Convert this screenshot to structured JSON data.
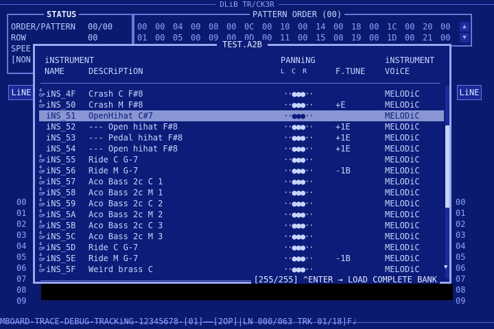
{
  "top_title": "DLiB TR/CK3R",
  "status": {
    "title": "STATUS",
    "lines": [
      {
        "label": "ORDER/PATTERN",
        "value": "00/00"
      },
      {
        "label": "ROW",
        "value": "00"
      },
      {
        "label": "SPEE",
        "value": ""
      },
      {
        "label": "[NON",
        "value": ""
      }
    ]
  },
  "pattern_order": {
    "title": "PATTERN ORDER (00)",
    "row1": [
      "00",
      "00",
      "04",
      "00",
      "08",
      "00",
      "0C",
      "00",
      "10",
      "00",
      "14",
      "00",
      "18",
      "00",
      "1C",
      "00",
      "20",
      "00"
    ],
    "row2": [
      "01",
      "00",
      "05",
      "00",
      "09",
      "00",
      "0D",
      "00",
      "11",
      "00",
      "15",
      "00",
      "19",
      "00",
      "1D",
      "00",
      "21",
      "00"
    ]
  },
  "lin_label": "LiNE",
  "track_numbers": [
    "00",
    "01",
    "02",
    "03",
    "04",
    "05",
    "06",
    "07",
    "08",
    "09"
  ],
  "dialog": {
    "title": "TEST.A2B",
    "headers": {
      "instrument_top": "iNSTRUMENT",
      "name": "NAME",
      "description": "DESCRiPTiON",
      "panning": "PANNiNG",
      "pan_lcr": "L   C   R",
      "ftune": "F.TUNE",
      "instrument_voice_top": "iNSTRUMENT",
      "voice": "VOiCE"
    },
    "rows": [
      {
        "op": "4OP",
        "name": "iNS_4F",
        "desc": "Crash C F#8",
        "pan": "··●●●··",
        "tune": "",
        "voice": "MELODiC"
      },
      {
        "op": "4OP",
        "name": "iNS_50",
        "desc": "Crash M F#8",
        "pan": "··●●●··",
        "tune": "+E",
        "voice": "MELODiC"
      },
      {
        "op": "",
        "name": "iNS_51",
        "desc": "OpenHihat C#7",
        "pan": "··●●●··",
        "tune": "",
        "voice": "MELODiC"
      },
      {
        "op": "",
        "name": "iNS_52",
        "desc": "--- Open hihat F#8",
        "pan": "··●●●··",
        "tune": "+1E",
        "voice": "MELODiC"
      },
      {
        "op": "",
        "name": "iNS_53",
        "desc": "--- Pedal hihat F#8",
        "pan": "··●●●··",
        "tune": "+1E",
        "voice": "MELODiC"
      },
      {
        "op": "",
        "name": "iNS_54",
        "desc": "--- Open hihat F#8",
        "pan": "··●●●··",
        "tune": "+1E",
        "voice": "MELODiC"
      },
      {
        "op": "4OP",
        "name": "iNS_55",
        "desc": "Ride C G-7",
        "pan": "··●●●··",
        "tune": "",
        "voice": "MELODiC"
      },
      {
        "op": "4OP",
        "name": "iNS_56",
        "desc": "Ride M G-7",
        "pan": "··●●●··",
        "tune": "-1B",
        "voice": "MELODiC"
      },
      {
        "op": "4OP",
        "name": "iNS_57",
        "desc": "Aco Bass 2c C 1",
        "pan": "··●●●··",
        "tune": "",
        "voice": "MELODiC"
      },
      {
        "op": "4OP",
        "name": "iNS_58",
        "desc": "Aco Bass 2c M 1",
        "pan": "··●●●··",
        "tune": "",
        "voice": "MELODiC"
      },
      {
        "op": "4OP",
        "name": "iNS_59",
        "desc": "Aco Bass 2c C 2",
        "pan": "··●●●··",
        "tune": "",
        "voice": "MELODiC"
      },
      {
        "op": "4OP",
        "name": "iNS_5A",
        "desc": "Aco Bass 2c M 2",
        "pan": "··●●●··",
        "tune": "",
        "voice": "MELODiC"
      },
      {
        "op": "4OP",
        "name": "iNS_5B",
        "desc": "Aco Bass 2c C 3",
        "pan": "··●●●··",
        "tune": "",
        "voice": "MELODiC"
      },
      {
        "op": "4OP",
        "name": "iNS_5C",
        "desc": "Aco Bass 2c M 3",
        "pan": "··●●●··",
        "tune": "",
        "voice": "MELODiC"
      },
      {
        "op": "4OP",
        "name": "iNS_5D",
        "desc": "Ride C G-7",
        "pan": "··●●●··",
        "tune": "",
        "voice": "MELODiC"
      },
      {
        "op": "4OP",
        "name": "iNS_5E",
        "desc": "Ride M G-7",
        "pan": "··●●●··",
        "tune": "-1B",
        "voice": "MELODiC"
      },
      {
        "op": "4OP",
        "name": "iNS_5F",
        "desc": "Weird brass C",
        "pan": "··●●●··",
        "tune": "",
        "voice": "MELODiC"
      }
    ],
    "selected_index": 2,
    "footer": "[255/255] ^ENTER → LOAD COMPLETE BANK"
  },
  "bottom_bar": "MBOARD-TRACE-DEBUG-TRACKiNG-12345678-[01]——[2OP]|LN 000/063 TRK 01/18]F♩"
}
